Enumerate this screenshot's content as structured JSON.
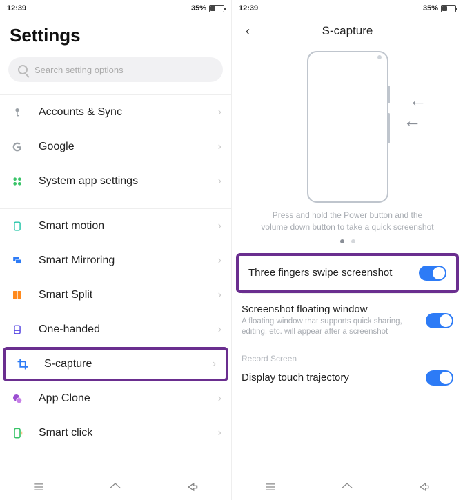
{
  "status": {
    "time": "12:39",
    "battery_pct": "35%"
  },
  "left": {
    "title": "Settings",
    "search_placeholder": "Search setting options",
    "items": [
      {
        "label": "Accounts & Sync",
        "icon": "key-icon",
        "color": "#9aa0a6"
      },
      {
        "label": "Google",
        "icon": "google-icon",
        "color": "#9aa0a6"
      },
      {
        "label": "System app settings",
        "icon": "apps-icon",
        "color": "#3ac469"
      },
      {
        "label": "Smart motion",
        "icon": "phone-icon",
        "color": "#27c6a9"
      },
      {
        "label": "Smart Mirroring",
        "icon": "cast-icon",
        "color": "#2d7bf6"
      },
      {
        "label": "Smart Split",
        "icon": "split-icon",
        "color": "#ff8a1e"
      },
      {
        "label": "One-handed",
        "icon": "onehand-icon",
        "color": "#5a4ae3"
      },
      {
        "label": "S-capture",
        "icon": "crop-icon",
        "color": "#2d7bf6",
        "highlight": true
      },
      {
        "label": "App Clone",
        "icon": "clone-icon",
        "color": "#9b4fd1"
      },
      {
        "label": "Smart click",
        "icon": "smartclick-icon",
        "color": "#3ac469"
      }
    ]
  },
  "right": {
    "title": "S-capture",
    "caption": "Press and hold the Power button and the volume down button to take a quick screenshot",
    "settings": {
      "three_finger": {
        "label": "Three fingers swipe screenshot",
        "on": true,
        "highlight": true
      },
      "floating": {
        "label": "Screenshot floating window",
        "desc": "A floating window that supports quick sharing, editing, etc. will appear after a screenshot",
        "on": true
      },
      "section": "Record Screen",
      "trajectory": {
        "label": "Display touch trajectory",
        "on": true
      }
    }
  }
}
